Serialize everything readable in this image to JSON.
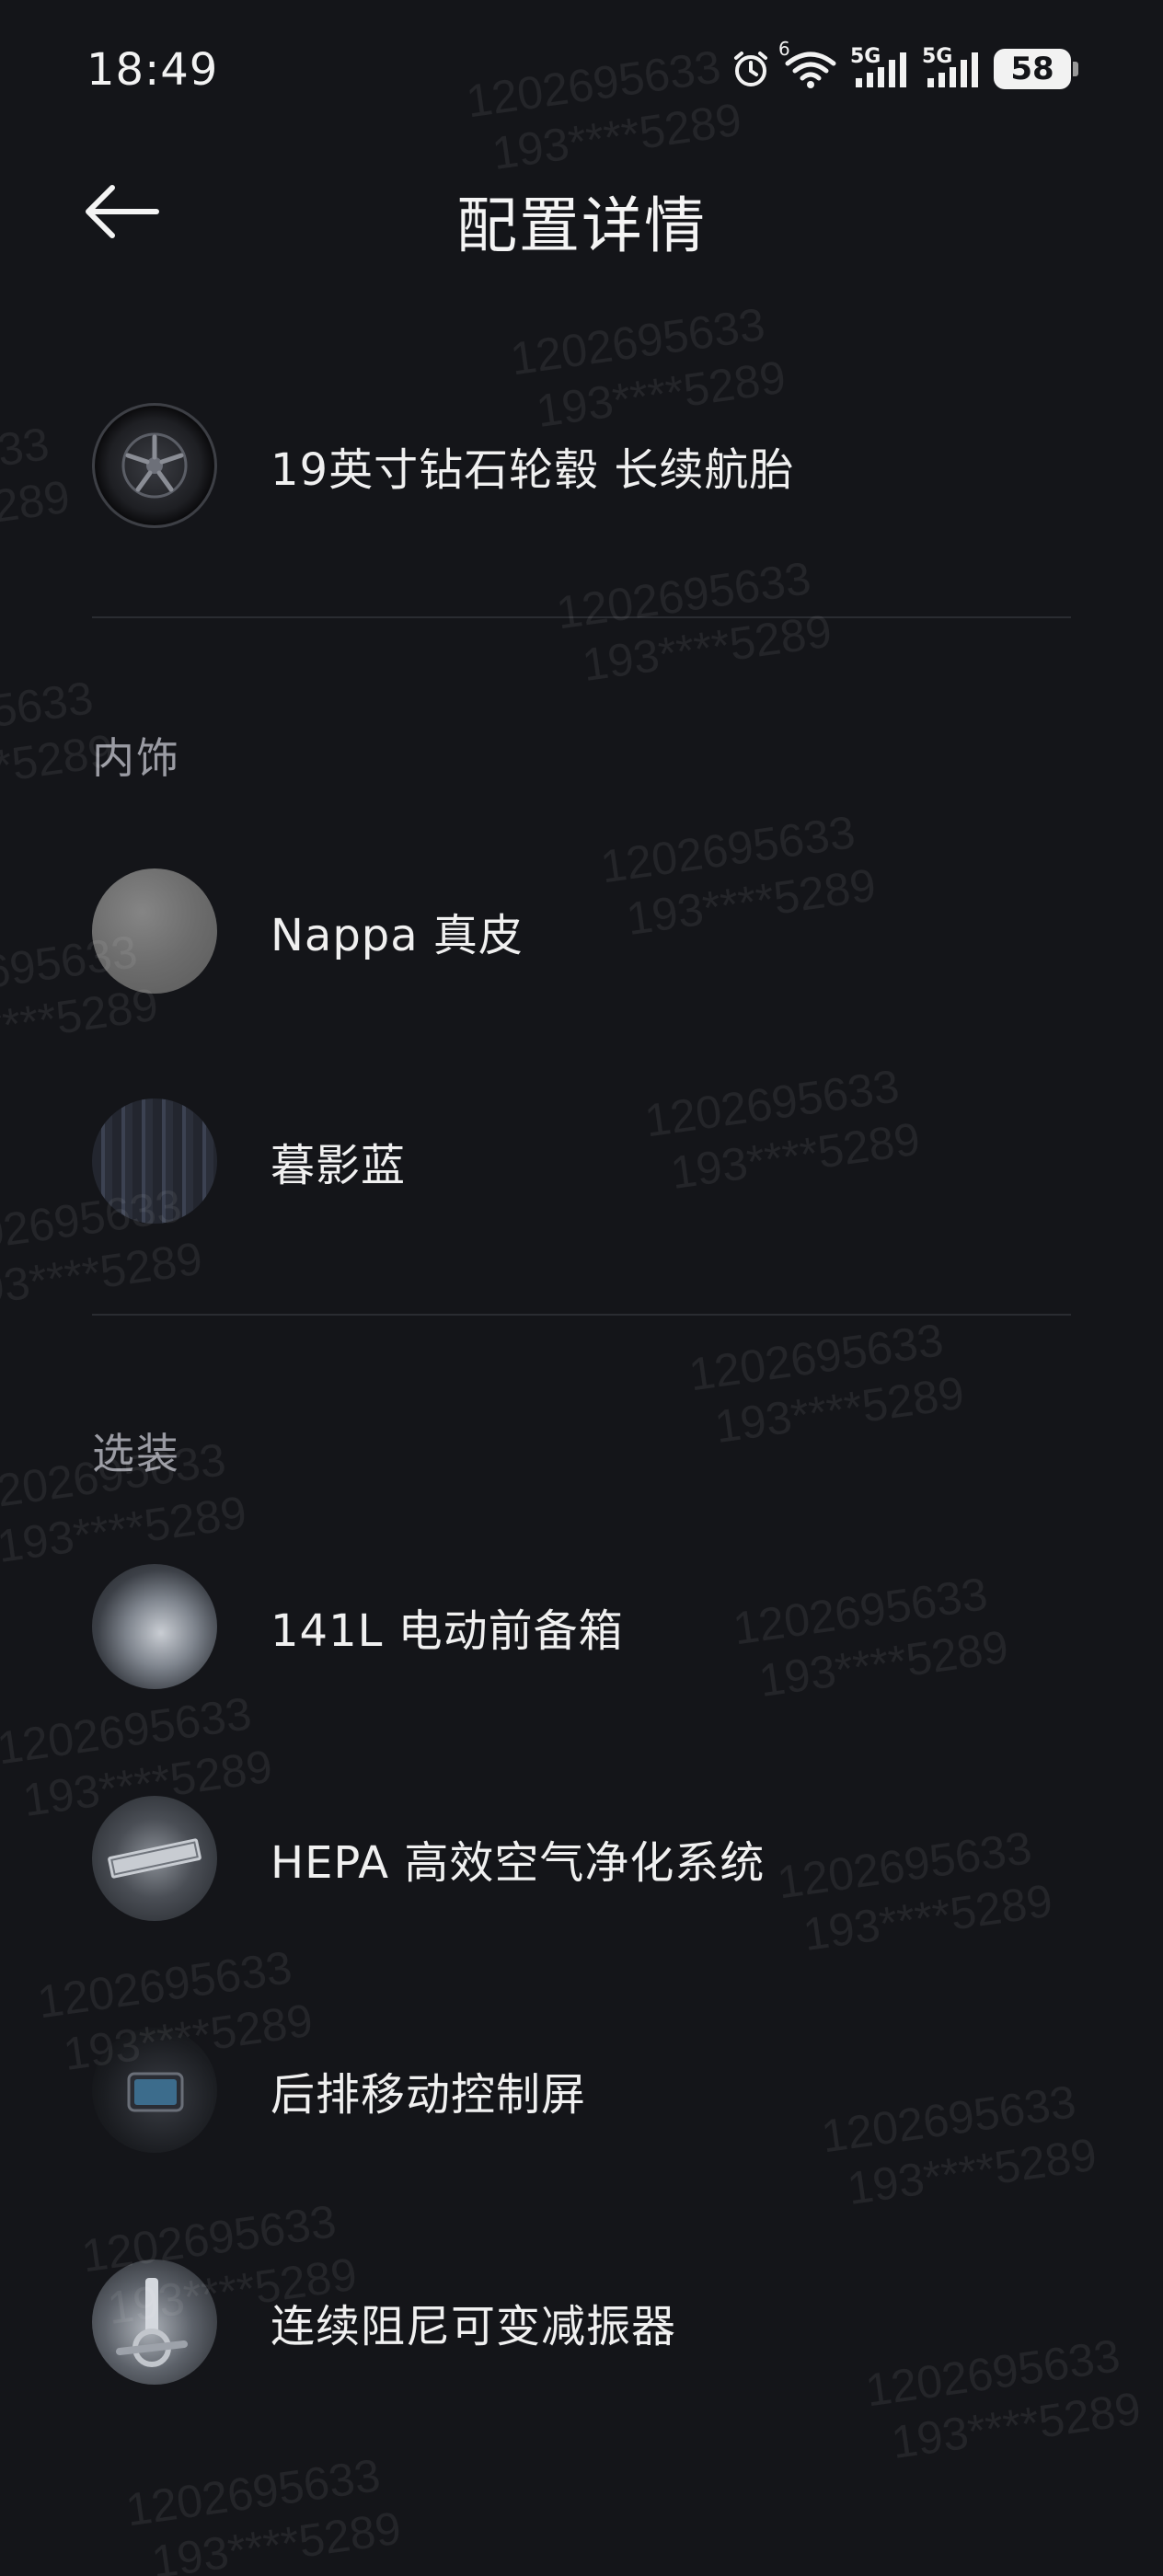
{
  "status_bar": {
    "time": "18:49",
    "network_1": "5G",
    "network_2": "5G",
    "wifi_badge": "6",
    "battery": "58",
    "icons": [
      "alarm-icon",
      "wifi-icon",
      "signal-icon",
      "signal-icon",
      "battery-icon"
    ]
  },
  "header": {
    "back_icon": "arrow-left-icon",
    "title": "配置详情"
  },
  "wheel_item": {
    "label": "19英寸钻石轮毂 长续航胎"
  },
  "interior": {
    "section_title": "内饰",
    "items": [
      {
        "label": "Nappa 真皮"
      },
      {
        "label": "暮影蓝"
      }
    ]
  },
  "options": {
    "section_title": "选装",
    "items": [
      {
        "label": "141L 电动前备箱"
      },
      {
        "label": "HEPA 高效空气净化系统"
      },
      {
        "label": "后排移动控制屏"
      },
      {
        "label": "连续阻尼可变减振器"
      }
    ]
  },
  "watermark": {
    "line1": "1202695633",
    "line2": "193****5289"
  },
  "colors": {
    "background": "#141519",
    "text": "#ededee",
    "section_title": "#9a9ba3",
    "divider": "#2a2c31"
  }
}
